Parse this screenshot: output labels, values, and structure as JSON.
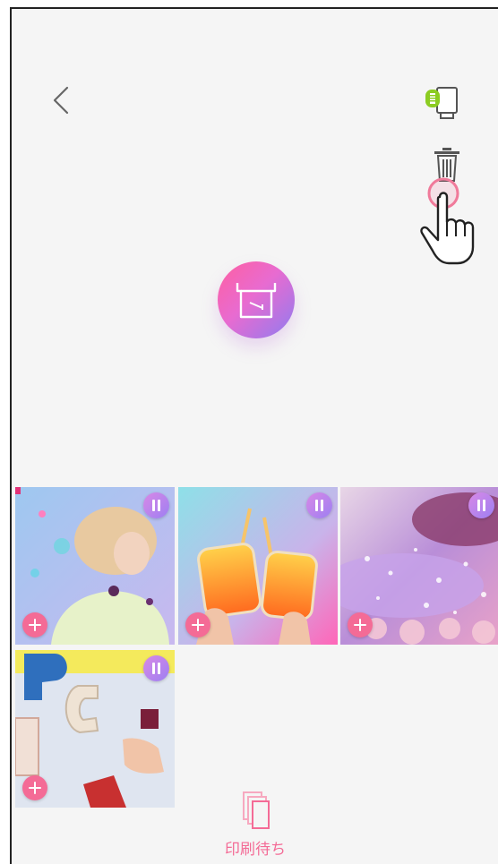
{
  "header": {
    "back_icon": "chevron-left-icon",
    "device_icon": "printer-battery-icon",
    "trash_icon": "trash-icon"
  },
  "print_button": {
    "icon": "printer-icon",
    "color_start": "#ff5fa0",
    "color_end": "#8f7cf0"
  },
  "photos": [
    {
      "name": "photo-girl-confetti",
      "state": "paused"
    },
    {
      "name": "photo-drinks-toast",
      "state": "paused"
    },
    {
      "name": "photo-glitter",
      "state": "paused"
    },
    {
      "name": "photo-letters",
      "state": "paused"
    }
  ],
  "bottom_tab": {
    "label": "印刷待ち",
    "icon": "print-queue-icon",
    "color": "#f46b96"
  }
}
